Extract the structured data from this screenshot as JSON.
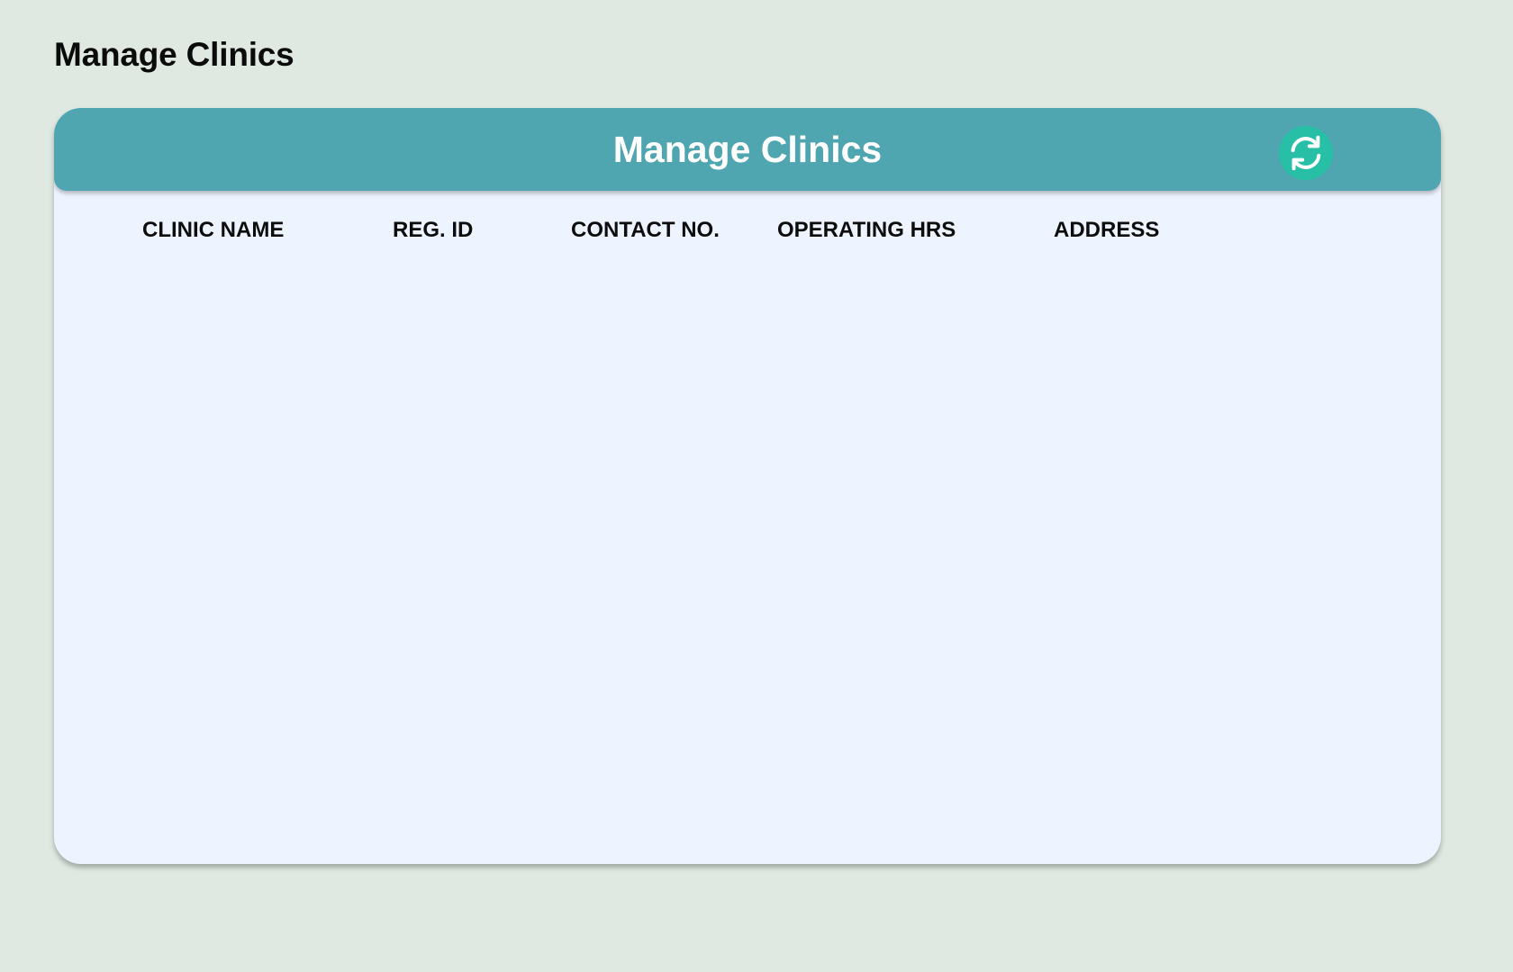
{
  "page": {
    "title": "Manage Clinics"
  },
  "card": {
    "title": "Manage Clinics",
    "header_color": "#4fa5b0",
    "refresh_button": {
      "icon": "refresh-icon",
      "color": "#27bfa6"
    }
  },
  "table": {
    "columns": [
      "CLINIC NAME",
      "REG. ID",
      "CONTACT NO.",
      "OPERATING HRS",
      "ADDRESS"
    ],
    "rows": []
  },
  "colors": {
    "background": "#dfe9e1",
    "card_background": "#edf3ff"
  }
}
